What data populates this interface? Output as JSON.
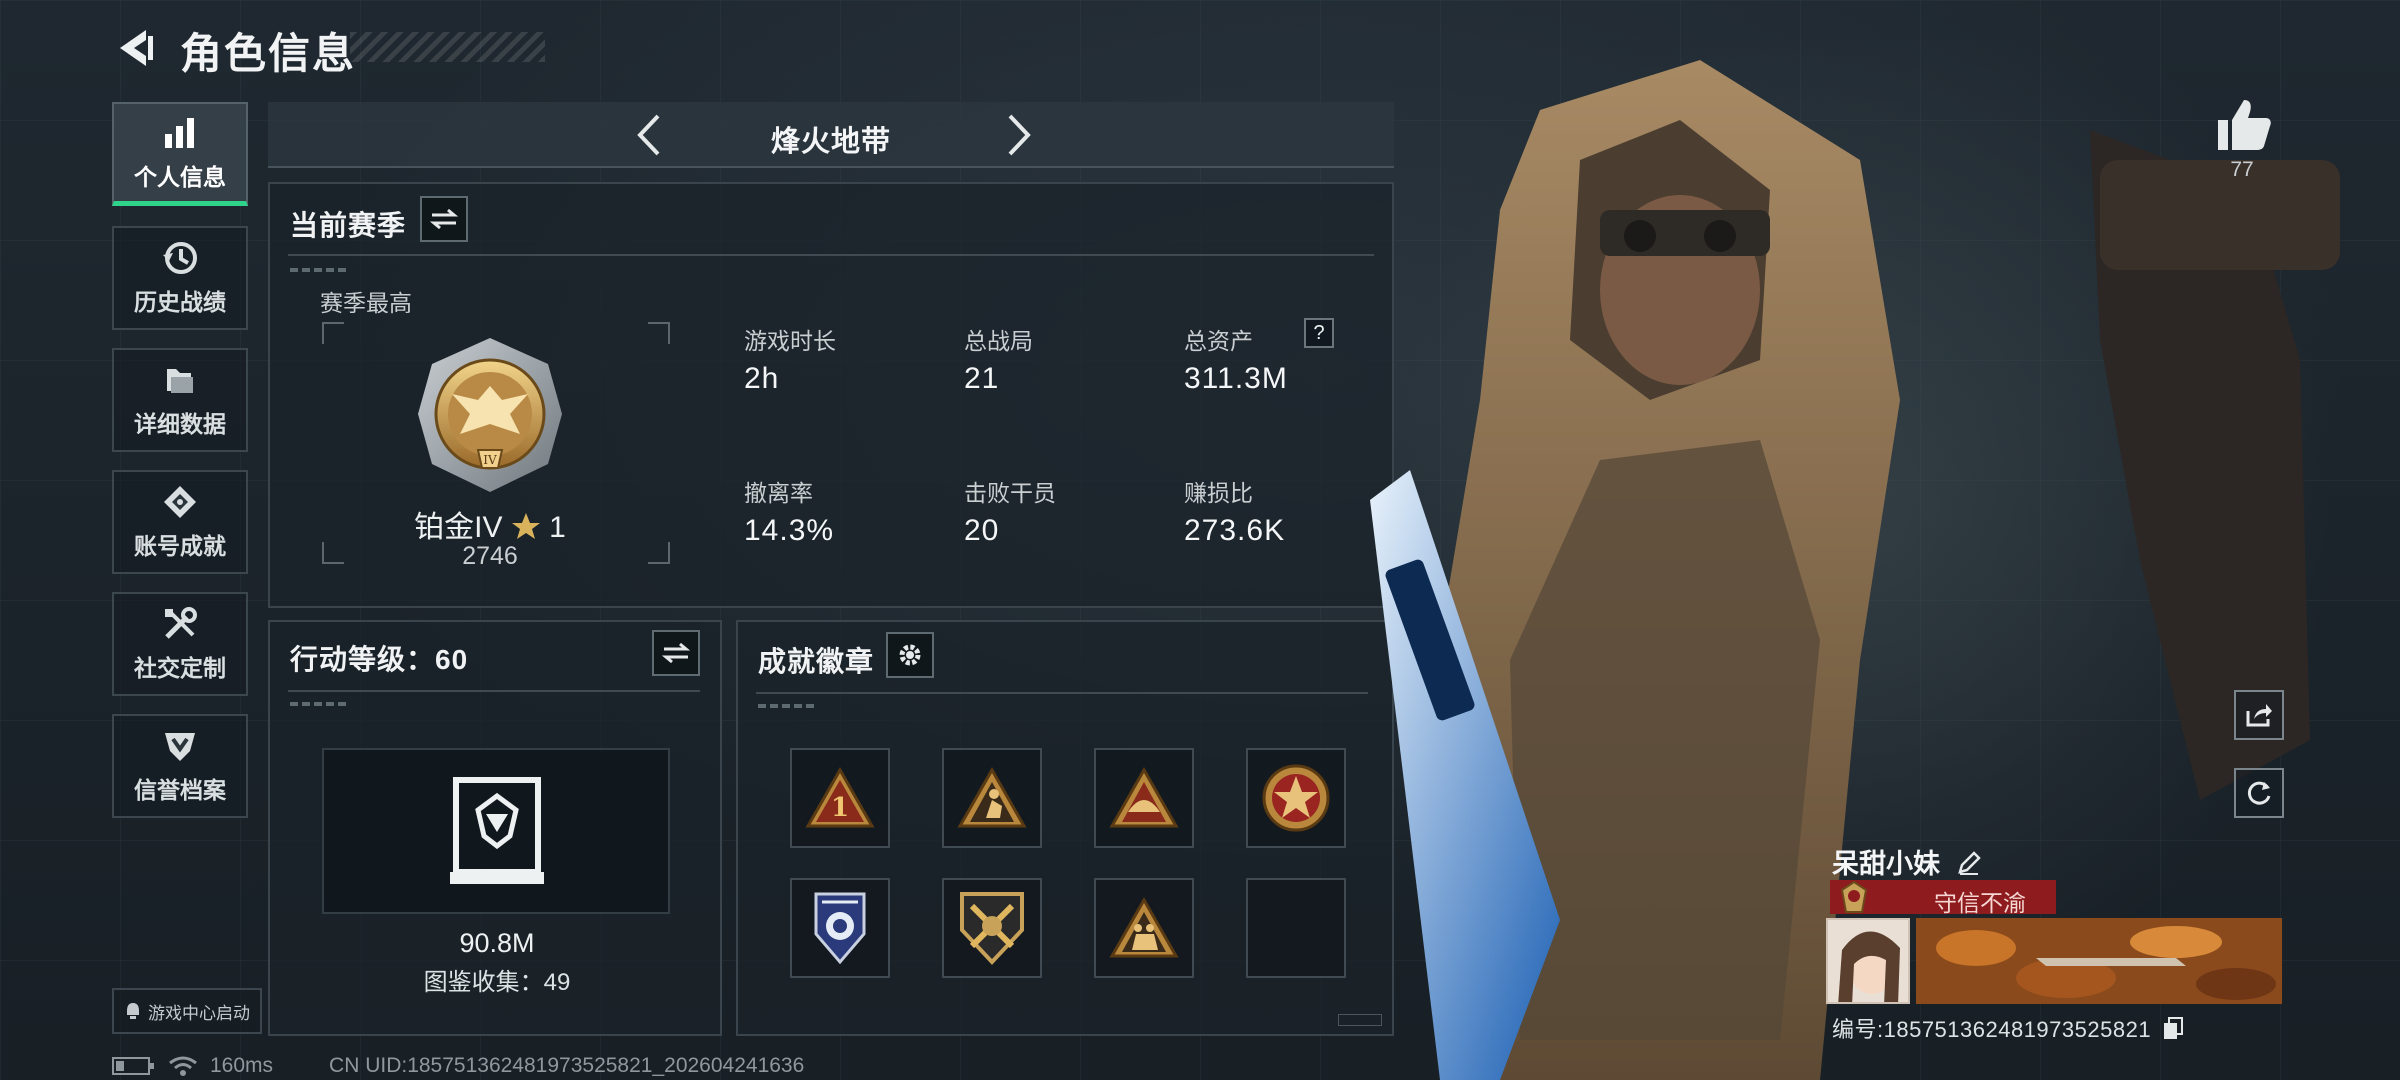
{
  "header": {
    "title": "角色信息",
    "back_icon": "back-arrow-icon"
  },
  "sidebar": {
    "items": [
      {
        "label": "个人信息",
        "icon": "bar-chart-icon",
        "active": true
      },
      {
        "label": "历史战绩",
        "icon": "history-clock-icon",
        "active": false
      },
      {
        "label": "详细数据",
        "icon": "folder-icon",
        "active": false
      },
      {
        "label": "账号成就",
        "icon": "medal-diamond-icon",
        "active": false
      },
      {
        "label": "社交定制",
        "icon": "tools-icon",
        "active": false
      },
      {
        "label": "信誉档案",
        "icon": "shield-icon",
        "active": false
      }
    ],
    "launch_label": "游戏中心启动"
  },
  "mode": {
    "name": "烽火地带"
  },
  "season": {
    "title": "当前赛季",
    "best_label": "赛季最高",
    "rank_name": "铂金IV",
    "rank_stars": "1",
    "rank_points": "2746",
    "stats": [
      {
        "label": "游戏时长",
        "value": "2h"
      },
      {
        "label": "总战局",
        "value": "21"
      },
      {
        "label": "总资产",
        "value": "311.3M",
        "help": "?"
      },
      {
        "label": "撤离率",
        "value": "14.3%"
      },
      {
        "label": "击败干员",
        "value": "20"
      },
      {
        "label": "赚损比",
        "value": "273.6K"
      }
    ]
  },
  "action_level": {
    "title": "行动等级：60",
    "value": "90.8M",
    "collection": "图鉴收集：49"
  },
  "badges": {
    "title": "成就徽章",
    "slots": [
      "badge-rank-1",
      "badge-climber",
      "badge-helmet",
      "badge-star-emblem",
      "badge-police",
      "badge-crossed-guns",
      "badge-soldiers",
      "empty"
    ]
  },
  "status": {
    "ping": "160ms",
    "uid": "CN UID:185751362481973525821_202604241636"
  },
  "profile": {
    "likes": "77",
    "name": "呆甜小妹",
    "title": "守信不渝",
    "id_label": "编号:185751362481973525821"
  },
  "colors": {
    "accent_green": "#2fd38a",
    "title_red": "#8e1c1f",
    "gold": "#c9a25a"
  }
}
